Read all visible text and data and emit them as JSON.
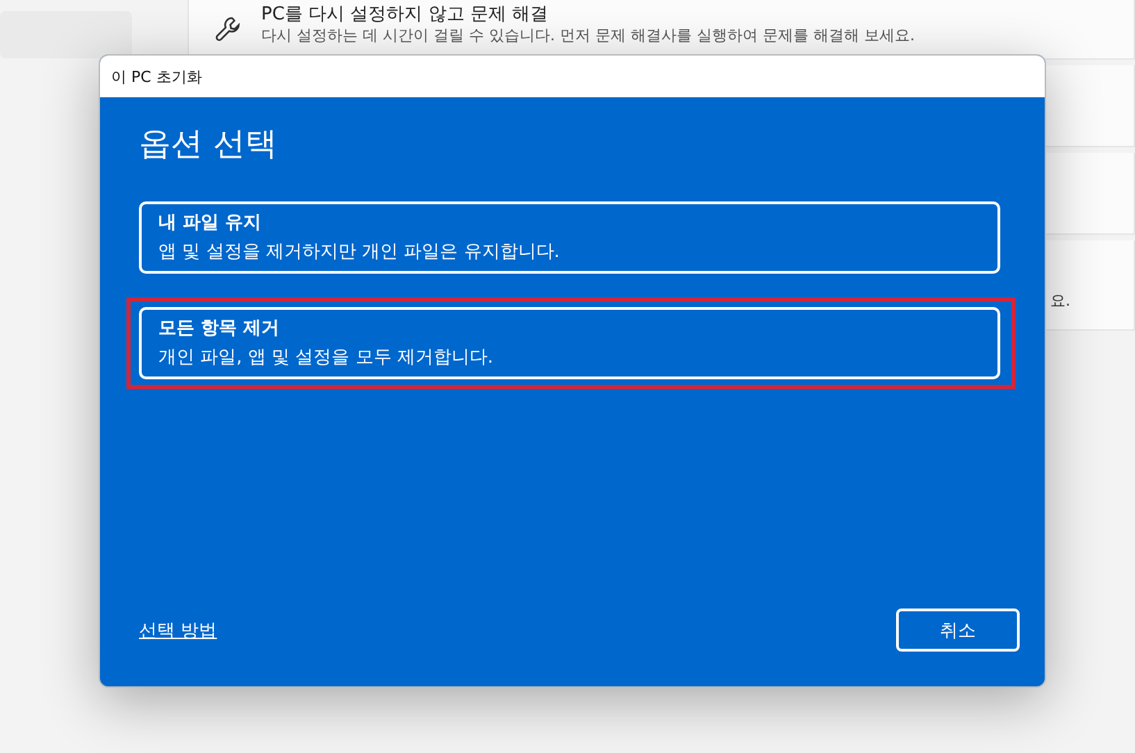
{
  "background": {
    "troubleshoot_card": {
      "title": "PC를 다시 설정하지 않고 문제 해결",
      "description": "다시 설정하는 데 시간이 걸릴 수 있습니다. 먼저 문제 해결사를 실행하여 문제를 해결해 보세요."
    },
    "partial_text": "요."
  },
  "dialog": {
    "title": "이 PC 초기화",
    "heading": "옵션 선택",
    "options": [
      {
        "title": "내 파일 유지",
        "description": "앱 및 설정을 제거하지만 개인 파일은 유지합니다.",
        "highlighted": false
      },
      {
        "title": "모든 항목 제거",
        "description": "개인 파일, 앱 및 설정을 모두 제거합니다.",
        "highlighted": true
      }
    ],
    "help_link": "선택 방법",
    "cancel_button": "취소"
  }
}
